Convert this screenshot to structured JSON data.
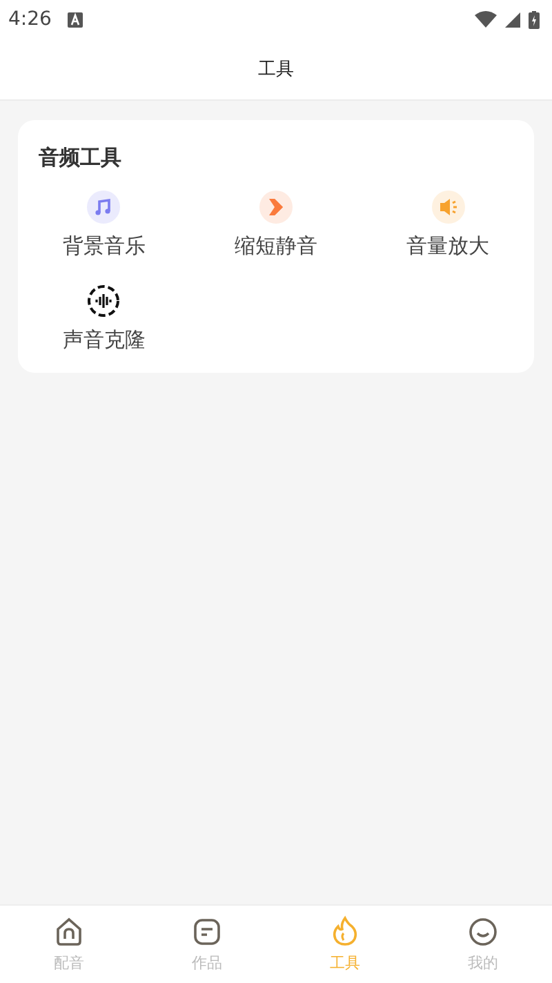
{
  "status_bar": {
    "time": "4:26"
  },
  "header": {
    "title": "工具"
  },
  "section": {
    "title": "音频工具",
    "tools": [
      {
        "label": "背景音乐"
      },
      {
        "label": "缩短静音"
      },
      {
        "label": "音量放大"
      },
      {
        "label": "声音克隆"
      }
    ]
  },
  "tabs": [
    {
      "label": "配音",
      "selected": false
    },
    {
      "label": "作品",
      "selected": false
    },
    {
      "label": "工具",
      "selected": true
    },
    {
      "label": "我的",
      "selected": false
    }
  ]
}
